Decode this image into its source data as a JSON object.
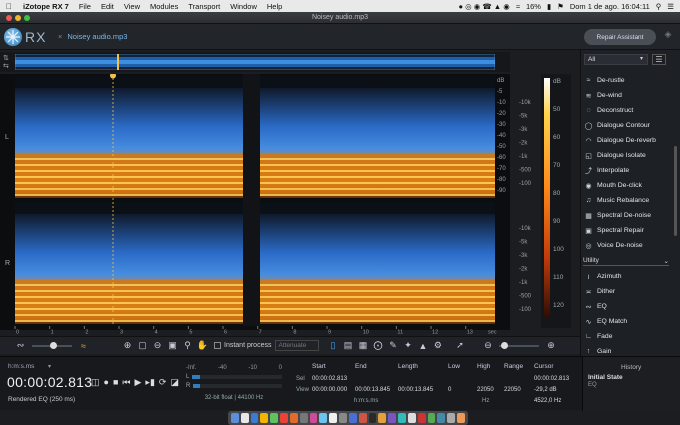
{
  "menubar": {
    "apple": "",
    "items": [
      "iZotope RX 7",
      "File",
      "Edit",
      "View",
      "Modules",
      "Transport",
      "Window",
      "Help"
    ],
    "battery": "16%",
    "datetime": "Dom 1 de ago.  16:04:11"
  },
  "window": {
    "title": "Noisey audio.mp3"
  },
  "app": {
    "logo_text": "RX",
    "file_tab": "Noisey audio.mp3",
    "repair_assistant": "Repair Assistant"
  },
  "channels": [
    "L",
    "R"
  ],
  "db_scale": {
    "right_labels_top": [
      "dB",
      "-5",
      "-10",
      "-20",
      "-30",
      "-40",
      "-50",
      "-60",
      "-70",
      "-80",
      "-90"
    ],
    "hz_labels_top": [
      "-10k",
      "-5k",
      "-3k",
      "-2k",
      "-1k",
      "-500",
      "-100"
    ],
    "right_labels_bottom": [
      "-10k",
      "-5k",
      "-3k",
      "-2k",
      "-1k",
      "-500",
      "-100"
    ],
    "meter_labels": [
      "dB",
      "50",
      "60",
      "70",
      "80",
      "90",
      "100",
      "110",
      "120"
    ]
  },
  "timeline": {
    "ticks": [
      "0",
      "1",
      "2",
      "3",
      "4",
      "5",
      "6",
      "7",
      "8",
      "9",
      "10",
      "11",
      "12",
      "13"
    ],
    "unit": "sec",
    "playhead_sec": 2.813
  },
  "toolbar": {
    "instant_process": "Instant process",
    "mode": "Attenuate"
  },
  "status": {
    "format_label": "h:m:s.ms",
    "timecode": "00:00:02.813",
    "rendered": "Rendered EQ (250 ms)",
    "level_nums": [
      "-Inf.",
      "-40",
      "-10",
      "0"
    ],
    "level_L": "L",
    "level_R": "R",
    "bit_info": "32-bit float | 44100 Hz",
    "selection": {
      "headers": [
        "Start",
        "End",
        "Length",
        "Low",
        "High",
        "Range",
        "Cursor"
      ],
      "sel_label": "Sel",
      "view_label": "View",
      "sel": [
        "00:00:02.813",
        "",
        "",
        "",
        "",
        "",
        "00:00:02.813"
      ],
      "view": [
        "00:00:00.000",
        "00:00:13.845",
        "00:00:13.845",
        "0",
        "22050",
        "22050",
        "-29,2 dB"
      ],
      "units": [
        "h:m:s.ms",
        "Hz"
      ],
      "cursor_hz": "4522,0 Hz"
    }
  },
  "history": {
    "title": "History",
    "state": "Initial State",
    "entry": "EQ"
  },
  "modules": {
    "filter_value": "All",
    "list_top": [
      {
        "label": "De-rustle",
        "icon": "rustle-icon"
      },
      {
        "label": "De-wind",
        "icon": "wind-icon"
      },
      {
        "label": "Deconstruct",
        "icon": "deconstruct-icon"
      },
      {
        "label": "Dialogue Contour",
        "icon": "contour-icon"
      },
      {
        "label": "Dialogue De-reverb",
        "icon": "dereverb-icon"
      },
      {
        "label": "Dialogue Isolate",
        "icon": "isolate-icon"
      },
      {
        "label": "Interpolate",
        "icon": "interpolate-icon"
      },
      {
        "label": "Mouth De-click",
        "icon": "mouth-icon"
      },
      {
        "label": "Music Rebalance",
        "icon": "rebalance-icon"
      },
      {
        "label": "Spectral De-noise",
        "icon": "denoise-icon"
      },
      {
        "label": "Spectral Repair",
        "icon": "repair-icon"
      },
      {
        "label": "Voice De-noise",
        "icon": "voice-icon"
      }
    ],
    "group_utility": "Utility",
    "list_utility": [
      {
        "label": "Azimuth",
        "icon": "azimuth-icon"
      },
      {
        "label": "Dither",
        "icon": "dither-icon"
      },
      {
        "label": "EQ",
        "icon": "eq-icon"
      },
      {
        "label": "EQ Match",
        "icon": "eqmatch-icon"
      },
      {
        "label": "Fade",
        "icon": "fade-icon"
      },
      {
        "label": "Gain",
        "icon": "gain-icon"
      }
    ]
  }
}
